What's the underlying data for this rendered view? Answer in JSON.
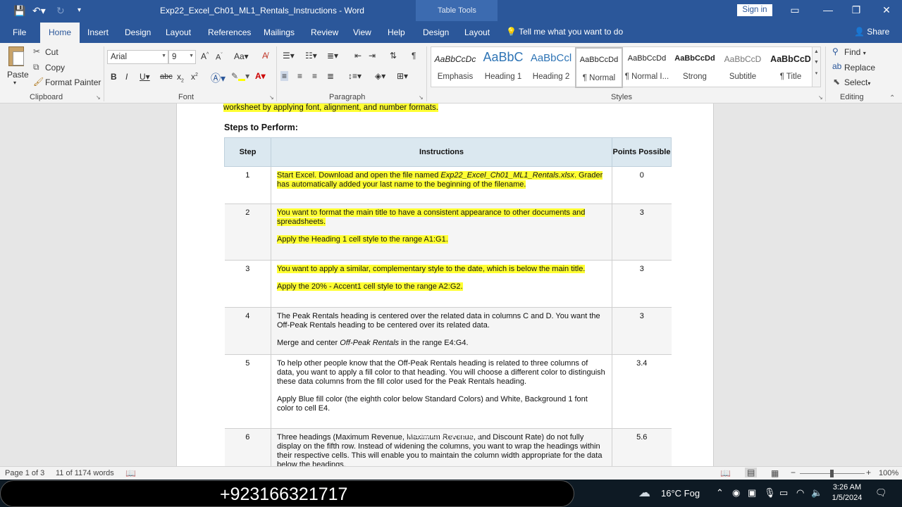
{
  "titlebar": {
    "doc_title": "Exp22_Excel_Ch01_ML1_Rentals_Instructions  -  Word",
    "table_tools": "Table Tools",
    "signin_label": "Sign in"
  },
  "tabs": [
    "File",
    "Home",
    "Insert",
    "Design",
    "Layout",
    "References",
    "Mailings",
    "Review",
    "View",
    "Help",
    "Design",
    "Layout"
  ],
  "tell_me": "Tell me what you want to do",
  "share": "Share",
  "ribbon": {
    "clipboard": {
      "paste": "Paste",
      "cut": "Cut",
      "copy": "Copy",
      "format_painter": "Format Painter",
      "label": "Clipboard"
    },
    "font": {
      "name": "Arial",
      "size": "9",
      "label": "Font"
    },
    "paragraph": {
      "label": "Paragraph"
    },
    "styles": {
      "label": "Styles",
      "items": [
        {
          "preview": "AaBbCcDc",
          "name": "Emphasis"
        },
        {
          "preview": "AaBbC",
          "name": "Heading 1"
        },
        {
          "preview": "AaBbCcl",
          "name": "Heading 2"
        },
        {
          "preview": "AaBbCcDd",
          "name": "¶ Normal"
        },
        {
          "preview": "AaBbCcDd",
          "name": "¶ Normal I..."
        },
        {
          "preview": "AaBbCcDd",
          "name": "Strong"
        },
        {
          "preview": "AaBbCcD",
          "name": "Subtitle"
        },
        {
          "preview": "AaBbCcD",
          "name": "¶ Title"
        }
      ]
    },
    "editing": {
      "find": "Find",
      "replace": "Replace",
      "select": "Select",
      "label": "Editing"
    }
  },
  "document": {
    "intro_tail": "worksheet by applying font, alignment, and number formats.",
    "steps_heading": "Steps to Perform:",
    "headers": {
      "step": "Step",
      "instructions": "Instructions",
      "points": "Points Possible"
    },
    "rows": [
      {
        "step": "1",
        "points": "0"
      },
      {
        "step": "2",
        "points": "3"
      },
      {
        "step": "3",
        "points": "3"
      },
      {
        "step": "4",
        "points": "3"
      },
      {
        "step": "5",
        "points": "3.4"
      },
      {
        "step": "6",
        "points": "5.6"
      }
    ],
    "r1": {
      "a": "Start Excel. Download and open the file named ",
      "file": "Exp22_Excel_Ch01_ML1_Rentals.xlsx",
      "b": ". Grader has automatically added your last name to the beginning of the filename."
    },
    "r2": {
      "p1": "You want to format the main title to have a consistent appearance to other documents and spreadsheets.",
      "p2": "Apply the Heading 1 cell style to the range A1:G1."
    },
    "r3": {
      "p1": "You want to apply a similar, complementary style to the date, which is below the main title.",
      "p2": "Apply the 20% - Accent1 cell style to the range A2:G2."
    },
    "r4": {
      "p1": "The Peak Rentals heading is centered over the related data in columns C and D. You want the Off-Peak Rentals heading to be centered over its related data.",
      "p2a": "Merge and center ",
      "p2i": "Off-Peak Rentals",
      "p2b": " in the range E4:G4."
    },
    "r5": {
      "p1": "To help other people know that the Off-Peak Rentals heading is related to three columns of data, you want to apply a fill color to that heading. You will choose a different color to distinguish these data columns from the fill color used for the Peak Rentals heading.",
      "p2": "Apply Blue fill color (the eighth color below Standard Colors) and White, Background 1 font color to cell E4."
    },
    "r6": {
      "p1": "Three headings (Maximum Revenue, Maximum Revenue, and Discount Rate) do not fully display on the fifth row. Instead of widening the columns, you want to wrap the headings within their respective cells. This will enable you to maintain the column width appropriate for the data below the headings."
    },
    "overlay": "Maximum Revenue"
  },
  "status": {
    "page": "Page 1 of 3",
    "words": "11 of 1174 words",
    "zoom": "100%"
  },
  "taskbar": {
    "phone": "+923166321717",
    "weather": "16°C  Fog",
    "time": "3:26 AM",
    "date": "1/5/2024"
  }
}
